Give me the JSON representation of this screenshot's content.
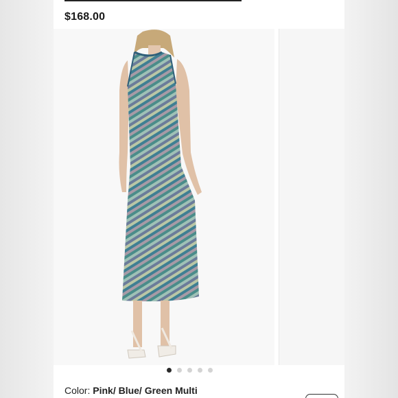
{
  "product": {
    "price": "$168.00",
    "color_label": "Color:",
    "color_value": "Pink/ Blue/ Green Multi"
  },
  "carousel": {
    "total_slides": 5,
    "active_index": 0
  },
  "icons": {
    "product_image": "dress-photo",
    "pager": "carousel-dot"
  },
  "colors": {
    "page_bg": "#e9e9e9",
    "panel_bg": "#ffffff",
    "text": "#222222",
    "dot_active": "#2a2a2a",
    "dot_inactive": "#d3d3d3"
  }
}
